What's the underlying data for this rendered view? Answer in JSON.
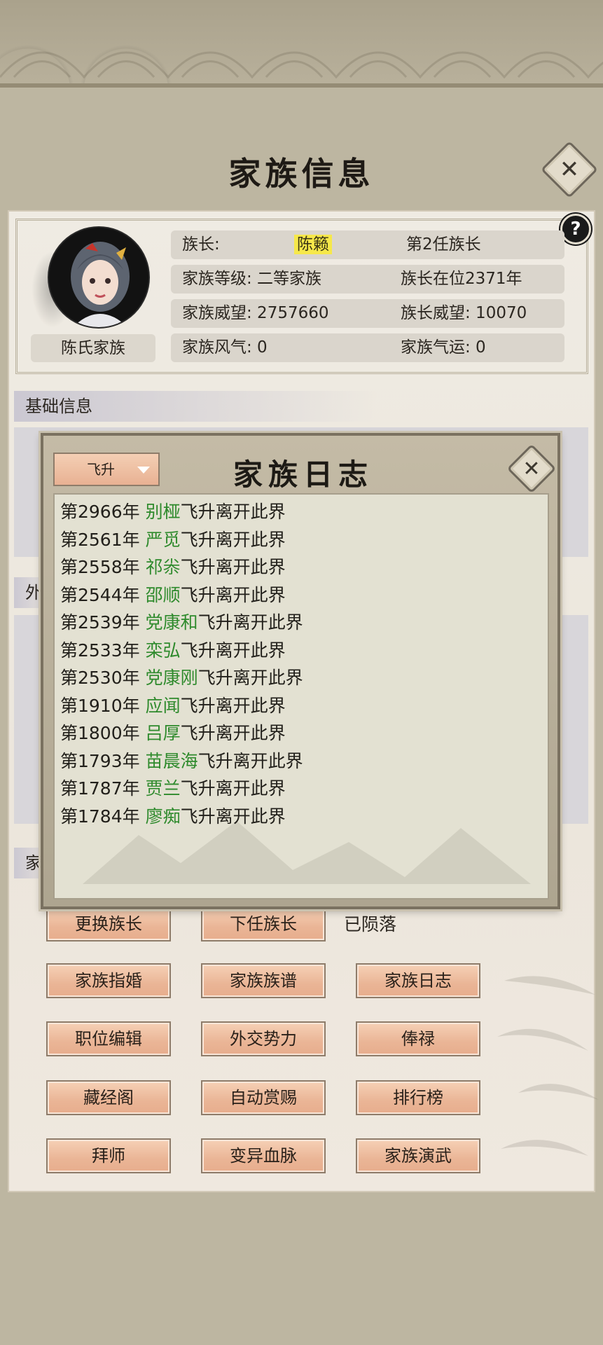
{
  "screen": {
    "title": "家族信息"
  },
  "header": {
    "leader_label": "族长:",
    "leader_name": "陈籁",
    "leader_rank": "第2任族长",
    "clan_level": "家族等级: 二等家族",
    "tenure": "族长在位2371年",
    "clan_prestige": "家族威望: 2757660",
    "leader_prestige": "族长威望: 10070",
    "clan_morale": "家族风气: 0",
    "clan_fortune": "家族气运: 0",
    "clan_name": "陈氏家族",
    "help": "?"
  },
  "sections": {
    "basic_info": "基础信息",
    "foreign_partial": "外",
    "family_partial": "家"
  },
  "dialog": {
    "title": "家族日志",
    "filter": {
      "selected": "飞升"
    },
    "close": "✕",
    "entries": [
      {
        "year": "第2966年",
        "name": "别桠",
        "event": "飞升离开此界"
      },
      {
        "year": "第2561年",
        "name": "严觅",
        "event": "飞升离开此界"
      },
      {
        "year": "第2558年",
        "name": "祁尜",
        "event": "飞升离开此界"
      },
      {
        "year": "第2544年",
        "name": "邵顺",
        "event": "飞升离开此界"
      },
      {
        "year": "第2539年",
        "name": "党康和",
        "event": "飞升离开此界"
      },
      {
        "year": "第2533年",
        "name": "栾弘",
        "event": "飞升离开此界"
      },
      {
        "year": "第2530年",
        "name": "党康刚",
        "event": "飞升离开此界"
      },
      {
        "year": "第1910年",
        "name": "应闻",
        "event": "飞升离开此界"
      },
      {
        "year": "第1800年",
        "name": "吕厚",
        "event": "飞升离开此界"
      },
      {
        "year": "第1793年",
        "name": "苗晨海",
        "event": "飞升离开此界"
      },
      {
        "year": "第1787年",
        "name": "贾兰",
        "event": "飞升离开此界"
      },
      {
        "year": "第1784年",
        "name": "廖痴",
        "event": "飞升离开此界"
      }
    ]
  },
  "actions": {
    "change_leader": "更换族长",
    "next_leader": "下任族长",
    "status": "已陨落",
    "marriage": "家族指婚",
    "genealogy": "家族族谱",
    "log": "家族日志",
    "positions": "职位编辑",
    "diplomacy": "外交势力",
    "salary": "俸禄",
    "library": "藏经阁",
    "auto_reward": "自动赏赐",
    "ranking": "排行榜",
    "mentor": "拜师",
    "bloodline": "变异血脉",
    "martial": "家族演武"
  },
  "main_close": "✕",
  "colors": {
    "accent_green": "#2e8a2c",
    "highlight_yellow": "#f6e84a",
    "button_peach": "#eab596"
  }
}
